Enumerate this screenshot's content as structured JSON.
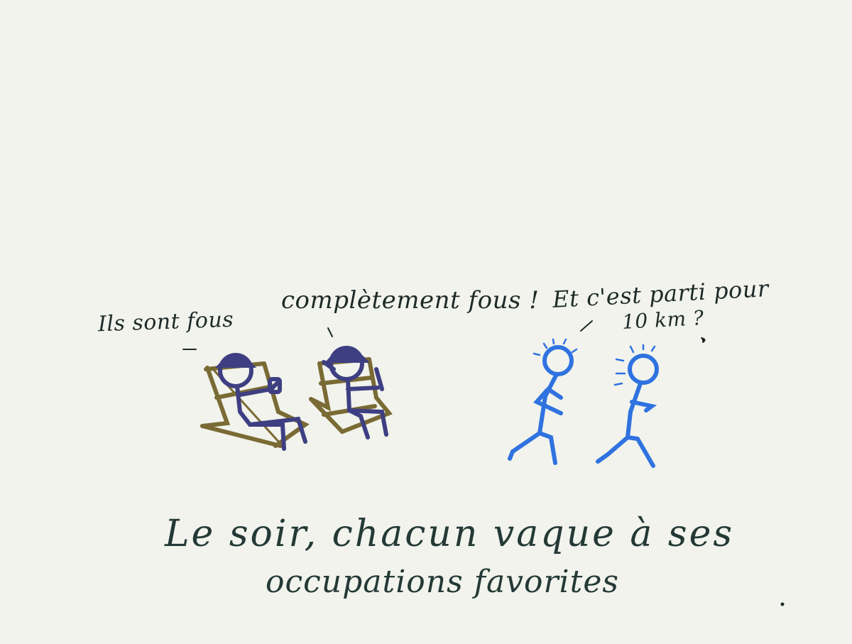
{
  "speech": {
    "left_person": "Ils sont fous",
    "middle_person": "complètement fous !",
    "runners_line1": "Et c'est parti pour",
    "runners_line2": "10 km ?"
  },
  "caption": {
    "line1": "Le soir, chacun vaque à ses",
    "line2": "occupations favorites"
  },
  "colors": {
    "background": "#f1f3ec",
    "ink": "#1e2a28",
    "sitters": "#3e3f82",
    "chairs": "#7a6a34",
    "runners": "#2f72e0"
  }
}
